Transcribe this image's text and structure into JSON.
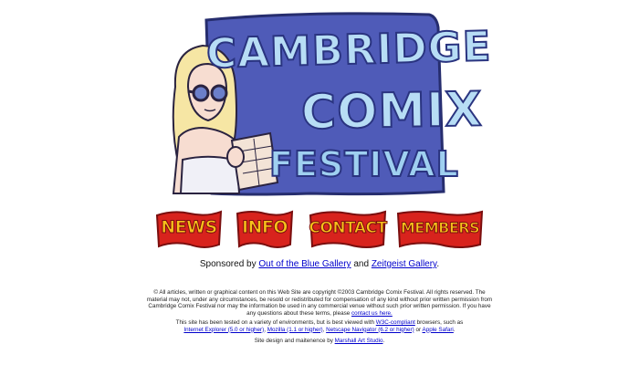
{
  "logo": {
    "line1": "CAMBRIDGE",
    "line2": "COMIX",
    "line3": "FESTIVAL",
    "colors": {
      "banner": "#4f5bb8",
      "banner_outline": "#262d6e",
      "letters": "#b7ddf5"
    }
  },
  "nav": {
    "items": [
      {
        "label": "NEWS"
      },
      {
        "label": "INFO"
      },
      {
        "label": "CONTACT"
      },
      {
        "label": "MEMBERS"
      }
    ],
    "colors": {
      "flag": "#d8231d",
      "letters": "#f6c21a"
    }
  },
  "sponsor": {
    "prefix": "Sponsored by",
    "link1": "Out of the Blue Gallery",
    "middle": "and",
    "link2": "Zeitgeist Gallery",
    "suffix": "."
  },
  "copyright": {
    "text": "© All articles, written or graphical content on this Web Site are copyright ©2003 Cambridge Comix Festival. All rights reserved. The material may not, under any circumstances, be resold or redistributed for compensation of any kind without prior written permission from Cambridge Comix Festival nor may the information be used in any commercial venue without such prior written permission. If you have any questions about these terms, please",
    "link": "contact us here.",
    "suffix": ""
  },
  "tested": {
    "prefix": "This site has been tested on a variety of environments, but is best viewed with",
    "w3c": "W3C-compliant",
    "mid1": "browsers, such as",
    "ie": "Internet Explorer (5.0 or higher)",
    "comma1": ",",
    "mozilla": "Mozilla (1.1 or higher)",
    "comma2": ",",
    "netscape": "Netscape Navigator (6.2 or higher)",
    "or": "or",
    "safari": "Apple Safari",
    "end": "."
  },
  "credits": {
    "prefix": "Site design and maitenence by",
    "link": "Marshall Art Studio",
    "end": "."
  }
}
